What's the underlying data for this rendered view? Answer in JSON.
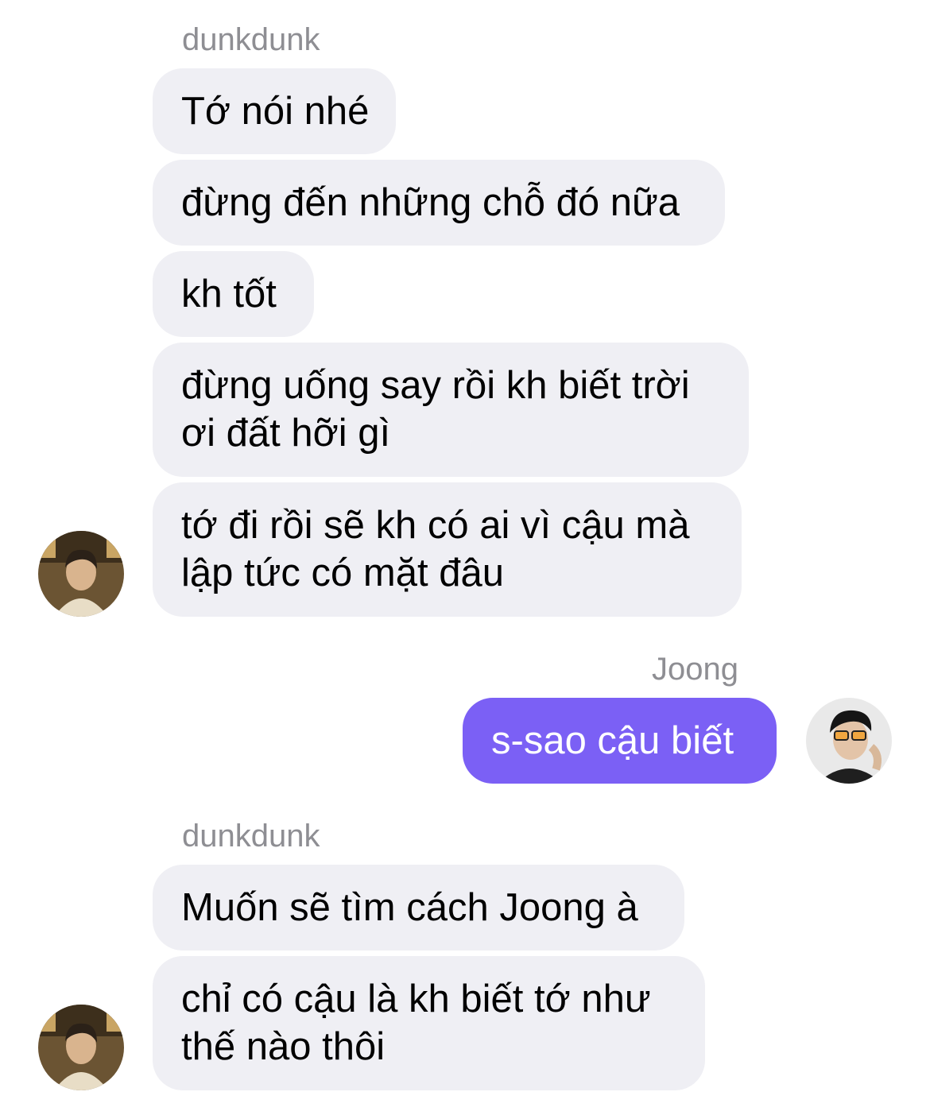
{
  "conversation": {
    "group1": {
      "sender": "dunkdunk",
      "messages": [
        "Tớ nói nhé",
        "đừng đến những chỗ đó nữa",
        "kh tốt",
        "đừng uống say rồi kh biết trời\nơi đất hỡi gì",
        "tớ đi rồi sẽ kh có ai vì cậu mà\nlập tức có mặt đâu"
      ]
    },
    "group2": {
      "sender": "Joong",
      "messages": [
        "s-sao cậu biết"
      ]
    },
    "group3": {
      "sender": "dunkdunk",
      "messages": [
        "Muốn sẽ tìm cách Joong à",
        "chỉ có cậu là kh biết tớ như\nthế nào thôi"
      ]
    }
  },
  "colors": {
    "incoming_bubble": "#efeff4",
    "outgoing_bubble": "#7b60f5",
    "sender_name": "#8e8e93"
  },
  "icons": {
    "dunkdunk_avatar": "avatar-photo",
    "joong_avatar": "avatar-photo"
  }
}
